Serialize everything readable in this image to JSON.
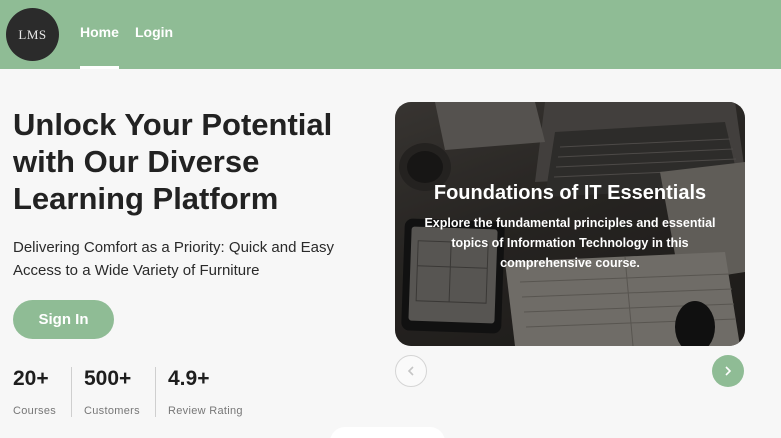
{
  "header": {
    "logo_text": "LMS",
    "nav": [
      {
        "label": "Home"
      },
      {
        "label": "Login"
      }
    ],
    "accent_color": "#8fbc95"
  },
  "hero": {
    "title": "Unlock Your Potential with Our Diverse Learning Platform",
    "subtitle": "Delivering Comfort as a Priority: Quick and Easy Access to a Wide Variety of Furniture",
    "signin_label": "Sign In"
  },
  "stats": [
    {
      "value": "20+",
      "label": "Courses"
    },
    {
      "value": "500+",
      "label": "Customers"
    },
    {
      "value": "4.9+",
      "label": "Review Rating"
    }
  ],
  "carousel": {
    "title": "Foundations of IT Essentials",
    "description": "Explore the fundamental principles and essential topics of Information Technology in this comprehensive course.",
    "prev_icon": "chevron-left-icon",
    "next_icon": "chevron-right-icon"
  }
}
